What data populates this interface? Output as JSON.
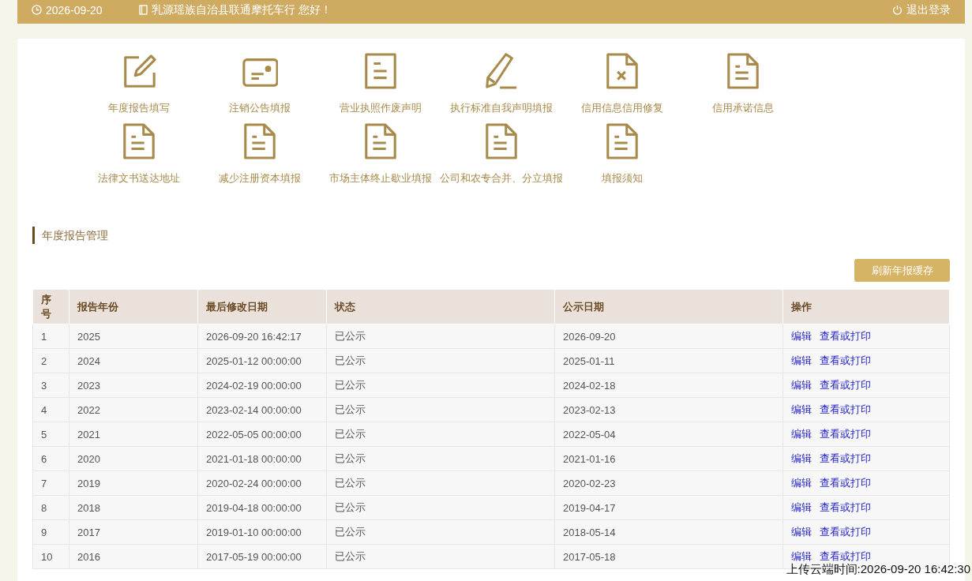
{
  "top_bar": {
    "date": "2026-09-20",
    "greeting": "乳源瑶族自治县联通摩托车行 您好！",
    "logout": "退出登录"
  },
  "shortcuts": [
    {
      "kind": "edit",
      "label": "年度报告填写"
    },
    {
      "kind": "card",
      "label": "注销公告填报"
    },
    {
      "kind": "doc",
      "label": "营业执照作废声明"
    },
    {
      "kind": "pencil",
      "label": "执行标准自我声明填报"
    },
    {
      "kind": "doc-x",
      "label": "信用信息信用修复"
    },
    {
      "kind": "file",
      "label": "信用承诺信息"
    },
    {
      "kind": "file",
      "label": "法律文书送达地址"
    },
    {
      "kind": "file",
      "label": "减少注册资本填报"
    },
    {
      "kind": "file",
      "label": "市场主体终止歇业填报"
    },
    {
      "kind": "file",
      "label": "公司和农专合并、分立填报"
    },
    {
      "kind": "file",
      "label": "填报须知"
    }
  ],
  "section_title": "年度报告管理",
  "refresh_button": "刷新年报缓存",
  "table": {
    "columns": [
      "序号",
      "报告年份",
      "最后修改日期",
      "状态",
      "公示日期",
      "操作"
    ],
    "rows": [
      {
        "no": "1",
        "year": "2025",
        "modified": "2026-09-20 16:42:17",
        "status": "已公示",
        "published": "2026-09-20",
        "actions": [
          "编辑",
          "查看或打印"
        ]
      },
      {
        "no": "2",
        "year": "2024",
        "modified": "2025-01-12 00:00:00",
        "status": "已公示",
        "published": "2025-01-11",
        "actions": [
          "编辑",
          "查看或打印"
        ]
      },
      {
        "no": "3",
        "year": "2023",
        "modified": "2024-02-19 00:00:00",
        "status": "已公示",
        "published": "2024-02-18",
        "actions": [
          "编辑",
          "查看或打印"
        ]
      },
      {
        "no": "4",
        "year": "2022",
        "modified": "2023-02-14 00:00:00",
        "status": "已公示",
        "published": "2023-02-13",
        "actions": [
          "编辑",
          "查看或打印"
        ]
      },
      {
        "no": "5",
        "year": "2021",
        "modified": "2022-05-05 00:00:00",
        "status": "已公示",
        "published": "2022-05-04",
        "actions": [
          "编辑",
          "查看或打印"
        ]
      },
      {
        "no": "6",
        "year": "2020",
        "modified": "2021-01-18 00:00:00",
        "status": "已公示",
        "published": "2021-01-16",
        "actions": [
          "编辑",
          "查看或打印"
        ]
      },
      {
        "no": "7",
        "year": "2019",
        "modified": "2020-02-24 00:00:00",
        "status": "已公示",
        "published": "2020-02-23",
        "actions": [
          "编辑",
          "查看或打印"
        ]
      },
      {
        "no": "8",
        "year": "2018",
        "modified": "2019-04-18 00:00:00",
        "status": "已公示",
        "published": "2019-04-17",
        "actions": [
          "编辑",
          "查看或打印"
        ]
      },
      {
        "no": "9",
        "year": "2017",
        "modified": "2019-01-10 00:00:00",
        "status": "已公示",
        "published": "2018-05-14",
        "actions": [
          "编辑",
          "查看或打印"
        ]
      },
      {
        "no": "10",
        "year": "2016",
        "modified": "2017-05-19 00:00:00",
        "status": "已公示",
        "published": "2017-05-18",
        "actions": [
          "编辑",
          "查看或打印"
        ]
      }
    ]
  },
  "upload_time": "上传云端时间:2026-09-20 16:42:30"
}
